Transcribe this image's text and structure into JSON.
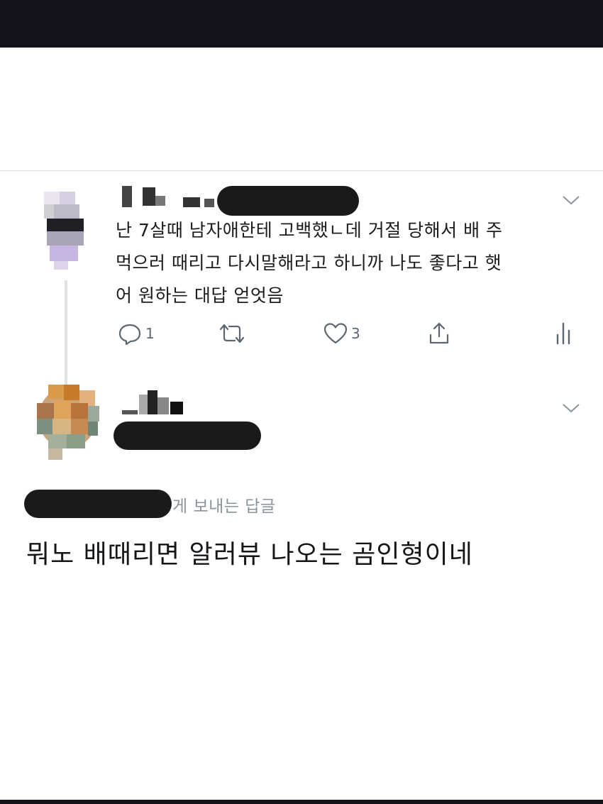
{
  "tweet": {
    "text_line1": "난 7살때 남자애한테 고백했ㄴ데 거절 당해서 배 주",
    "text_line2": "먹으러 때리고 다시말해라고 하니까 나도 좋다고 햇",
    "text_line3": "어 원하는 대답 얻엇음",
    "reply_count": "1",
    "like_count": "3",
    "icons": [
      "reply-icon",
      "retweet-icon",
      "like-icon",
      "share-icon",
      "analytics-icon",
      "chevron-down-icon"
    ]
  },
  "reply": {
    "replying_to_label": "게 보내는 답글",
    "text": "뭐노 배때리면 알러뷰 나오는 곰인형이네"
  },
  "colors": {
    "status_bar": "#13131c",
    "icon_gray": "#5b6670",
    "divider": "#d9dde1"
  }
}
